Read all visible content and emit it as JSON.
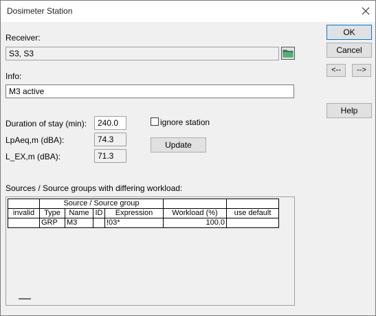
{
  "window": {
    "title": "Dosimeter Station"
  },
  "receiver": {
    "label": "Receiver:",
    "value": "S3, S3"
  },
  "info": {
    "label": "Info:",
    "value": "M3 active"
  },
  "stay": {
    "label": "Duration of stay (min):",
    "value": "240.0"
  },
  "lpaeq": {
    "label": "LpAeq,m (dBA):",
    "value": "74.3"
  },
  "lex": {
    "label": "L_EX,m (dBA):",
    "value": "71.3"
  },
  "ignore_station": {
    "label": "ignore station",
    "checked": false
  },
  "buttons": {
    "ok": "OK",
    "cancel": "Cancel",
    "prev": "<--",
    "next": "-->",
    "help": "Help",
    "update": "Update"
  },
  "sources": {
    "label": "Sources / Source groups with differing workload:",
    "group_header": "Source / Source group",
    "columns": [
      "invalid",
      "Type",
      "Name",
      "ID",
      "Expression",
      "Workload (%)",
      "use default"
    ],
    "rows": [
      {
        "invalid": "",
        "type": "GRP",
        "name": "M3",
        "id": "",
        "expression": "!03*",
        "workload": "100.0",
        "use_default": ""
      }
    ]
  },
  "colors": {
    "accent": "#0078d7",
    "folder_icon": "#2e8b57"
  },
  "icons": {
    "close": "close-icon",
    "folder": "folder-icon"
  }
}
